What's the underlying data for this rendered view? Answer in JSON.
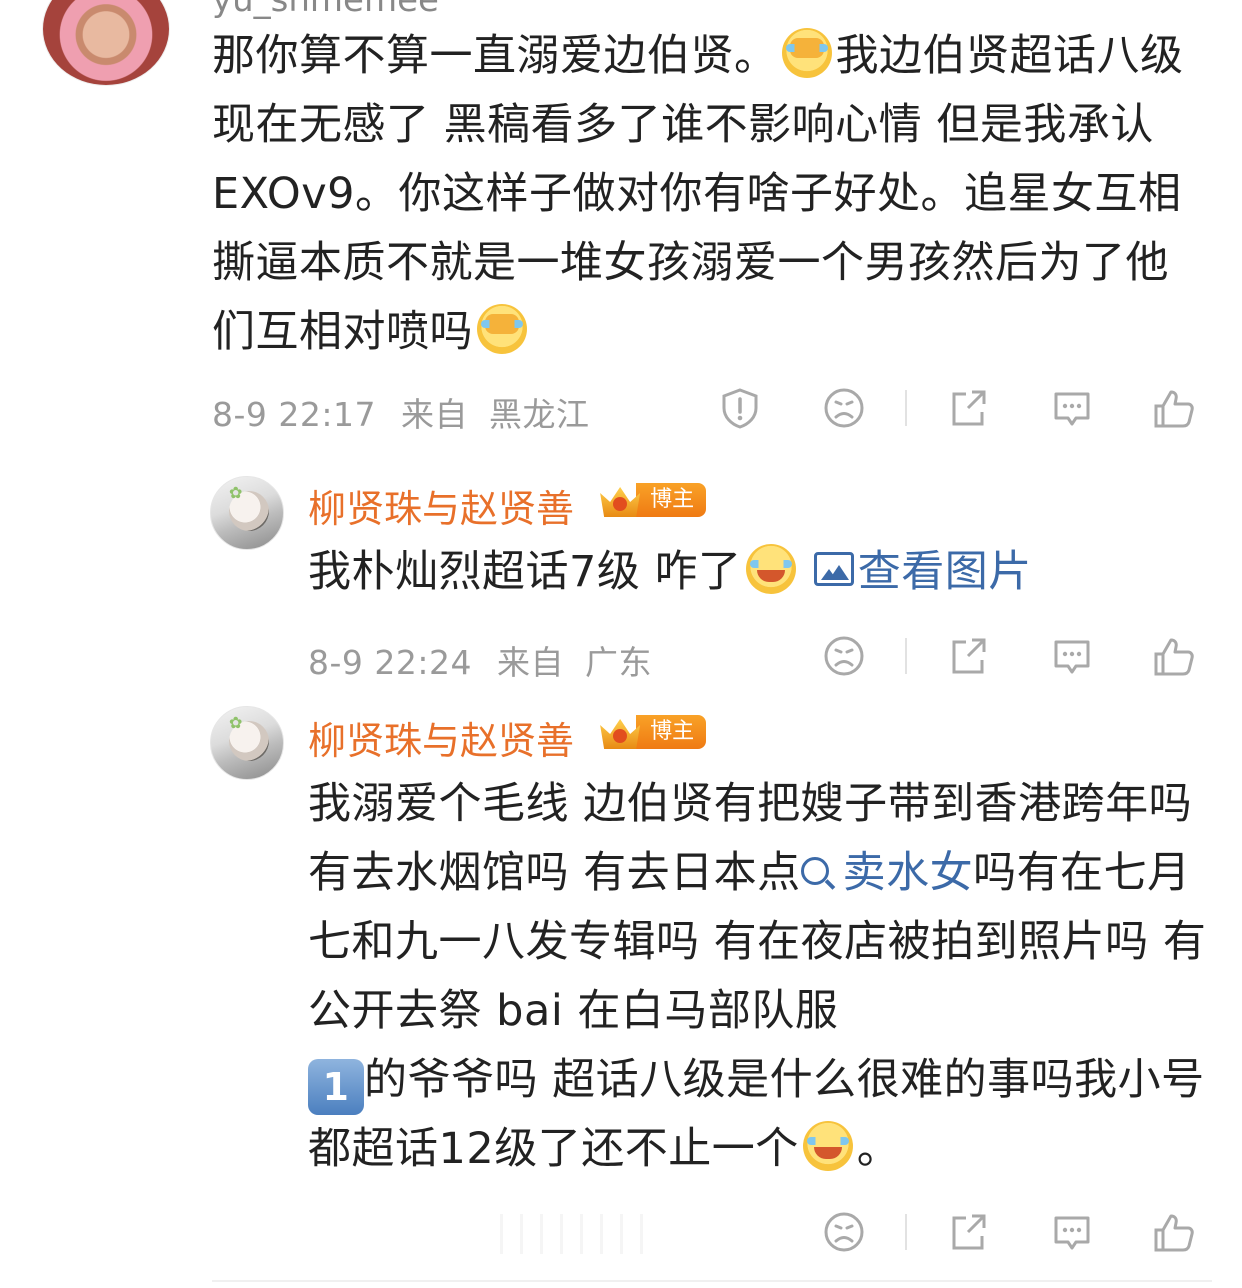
{
  "comments": [
    {
      "username": "yu_shmemee",
      "text_parts": [
        "那你算不算一直溺爱边伯贤。",
        "我边伯贤超话八级现在无感了 黑稿看多了谁不影响心情 但是我承认 EXOv9。你这样子做对你有啥子好处。追星女互相撕逼本质不就是一堆女孩溺爱一个男孩然后为了他们互相对喷吗"
      ],
      "emoji_1": "facepalm-emoji",
      "emoji_2": "facepalm-emoji",
      "time": "8-9 22:17",
      "from_label": "来自",
      "location": "黑龙江"
    },
    {
      "username": "柳贤珠与赵贤善",
      "badge": "博主",
      "text": "我朴灿烈超话7级 咋了",
      "emoji": "laugh-cry-emoji",
      "image_link": "查看图片",
      "time": "8-9 22:24",
      "from_label": "来自",
      "location": "广东"
    },
    {
      "username": "柳贤珠与赵贤善",
      "badge": "博主",
      "text_parts": [
        "我溺爱个毛线 边伯贤有把嫂子带到香港跨年吗 有去水烟馆吗 有去日本点",
        "卖水女",
        "吗有在七月七和九一八发专辑吗 有在夜店被拍到照片吗 有公开去祭 bai 在白马部队服",
        "的爷爷吗 超话八级是什么很难的事吗我小号都超话12级了还不止一个",
        "。"
      ],
      "keycap": "1",
      "emoji": "laugh-cry-emoji"
    }
  ],
  "colors": {
    "username": "#e8702a",
    "link": "#3c6aa8",
    "meta": "#9a9a9a",
    "text": "#222222"
  },
  "icons": [
    "report-icon",
    "dislike-face-icon",
    "share-icon",
    "comment-icon",
    "like-thumb-icon"
  ]
}
